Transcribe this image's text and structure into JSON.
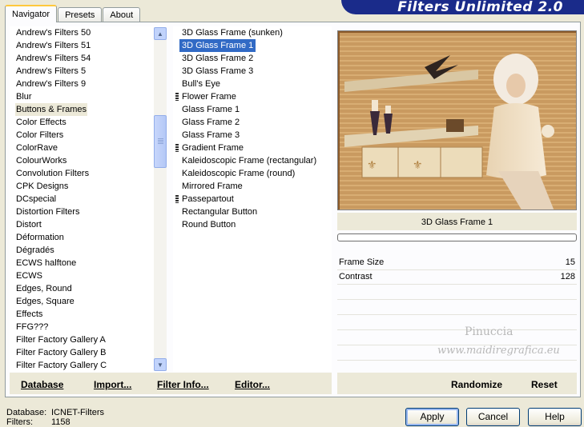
{
  "tabs": [
    "Navigator",
    "Presets",
    "About"
  ],
  "app_title": "Filters Unlimited 2.0",
  "categories": [
    "Andrew's Filters 50",
    "Andrew's Filters 51",
    "Andrew's Filters 54",
    "Andrew's Filters 5",
    "Andrew's Filters 9",
    "Blur",
    "Buttons & Frames",
    "Color Effects",
    "Color Filters",
    "ColorRave",
    "ColourWorks",
    "Convolution Filters",
    "CPK Designs",
    "DCspecial",
    "Distortion Filters",
    "Distort",
    "Déformation",
    "Dégradés",
    "ECWS halftone",
    "ECWS",
    "Edges, Round",
    "Edges, Square",
    "Effects",
    "FFG???",
    "Filter Factory Gallery A",
    "Filter Factory Gallery B",
    "Filter Factory Gallery C"
  ],
  "selected_category": "Buttons & Frames",
  "filters": [
    {
      "label": "3D Glass Frame (sunken)",
      "marker": false
    },
    {
      "label": "3D Glass Frame 1",
      "marker": false
    },
    {
      "label": "3D Glass Frame 2",
      "marker": false
    },
    {
      "label": "3D Glass Frame 3",
      "marker": false
    },
    {
      "label": "Bull's Eye",
      "marker": false
    },
    {
      "label": "Flower Frame",
      "marker": true
    },
    {
      "label": "Glass Frame 1",
      "marker": false
    },
    {
      "label": "Glass Frame 2",
      "marker": false
    },
    {
      "label": "Glass Frame 3",
      "marker": false
    },
    {
      "label": "Gradient Frame",
      "marker": true
    },
    {
      "label": "Kaleidoscopic Frame (rectangular)",
      "marker": false
    },
    {
      "label": "Kaleidoscopic Frame (round)",
      "marker": false
    },
    {
      "label": "Mirrored Frame",
      "marker": false
    },
    {
      "label": "Passepartout",
      "marker": true
    },
    {
      "label": "Rectangular Button",
      "marker": false
    },
    {
      "label": "Round Button",
      "marker": false
    }
  ],
  "selected_filter": "3D Glass Frame 1",
  "preview": {
    "filter_name": "3D Glass Frame 1",
    "progress": 0
  },
  "params": [
    {
      "label": "Frame Size",
      "value": "15"
    },
    {
      "label": "Contrast",
      "value": "128"
    }
  ],
  "watermark": {
    "line1": "Pinuccia",
    "line2": "www.maidiregrafica.eu"
  },
  "left_buttons": [
    "Database",
    "Import...",
    "Filter Info...",
    "Editor..."
  ],
  "right_buttons": [
    "Randomize",
    "Reset"
  ],
  "footer": {
    "database_label": "Database:",
    "database_value": "ICNET-Filters",
    "filters_label": "Filters:",
    "filters_value": "1158"
  },
  "dialog_buttons": {
    "apply": "Apply",
    "cancel": "Cancel",
    "help": "Help"
  },
  "colors": {
    "banner": "#1a2b8a",
    "selection": "#316ac5",
    "tab_highlight": "#ffc83c"
  }
}
